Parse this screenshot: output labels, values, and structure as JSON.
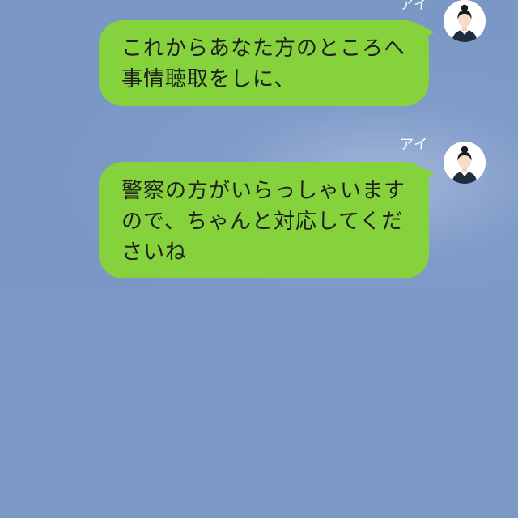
{
  "messages": [
    {
      "sender": "アイ",
      "text": "これからあなた方のところへ\n事情聴取をしに、",
      "avatar_icon": "woman-avatar-icon"
    },
    {
      "sender": "アイ",
      "text": "警察の方がいらっしゃいます\nので、ちゃんと対応してくだ\nさいね",
      "avatar_icon": "woman-avatar-icon"
    }
  ],
  "colors": {
    "background": "#7b97c6",
    "bubble": "#86d23d"
  }
}
